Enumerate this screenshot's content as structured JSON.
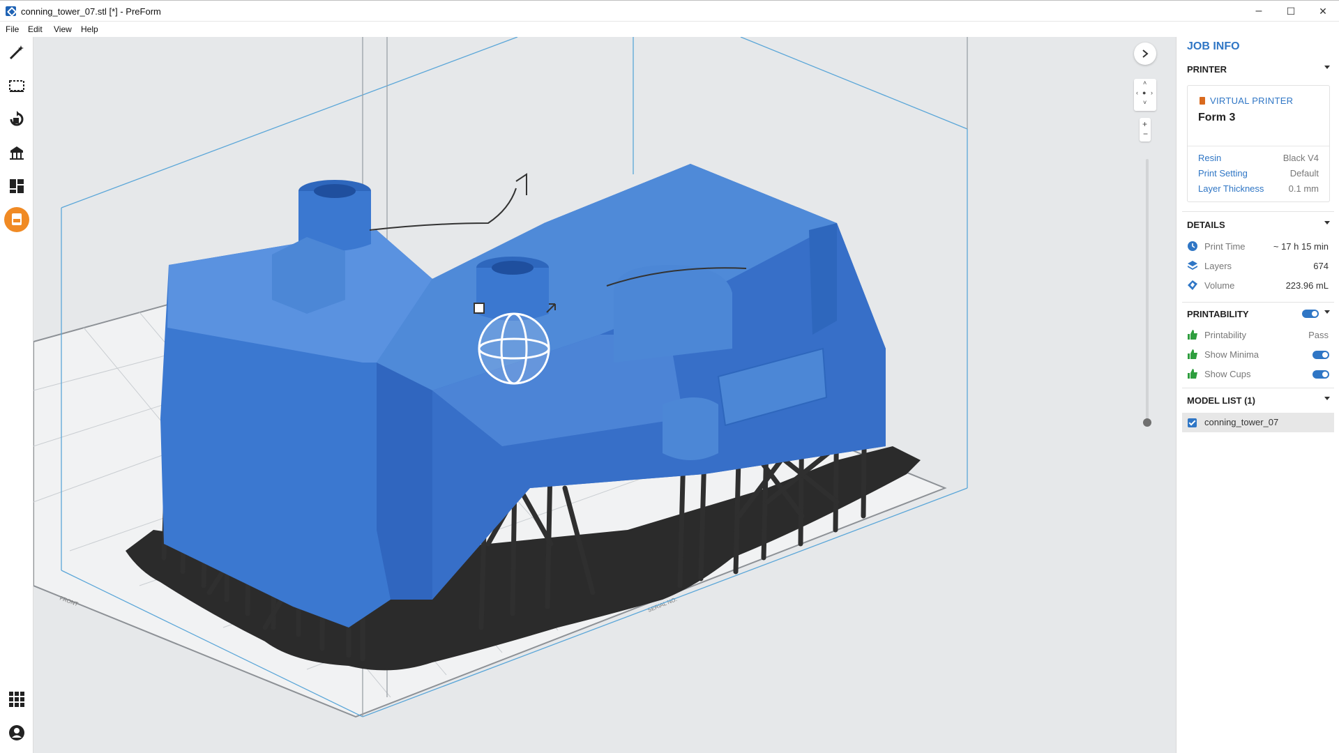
{
  "window": {
    "title": "conning_tower_07.stl [*] - PreForm",
    "minimize": "–",
    "maximize": "☐",
    "close": "✕"
  },
  "menu": [
    "File",
    "Edit",
    "View",
    "Help"
  ],
  "toolbar": {
    "tools": [
      "magic-wand-icon",
      "select-box-icon",
      "orientation-icon",
      "supports-icon",
      "layout-icon",
      "print-icon"
    ],
    "bottom": [
      "apps-grid-icon",
      "account-icon"
    ],
    "active_tool_color": "#f08a24"
  },
  "viewport": {
    "background": "#e6e8ea",
    "model_color": "#3b78d0",
    "support_color": "#2b2b2b",
    "build_box_color": "#5aa6d8",
    "platform_labels": [
      "FRONT",
      "SERIAL NO."
    ]
  },
  "job_info": {
    "title": "JOB INFO",
    "printer": {
      "header": "PRINTER",
      "virtual_label": "VIRTUAL PRINTER",
      "name": "Form 3",
      "rows": [
        {
          "label": "Resin",
          "value": "Black V4"
        },
        {
          "label": "Print Setting",
          "value": "Default"
        },
        {
          "label": "Layer Thickness",
          "value": "0.1 mm"
        }
      ]
    },
    "details": {
      "header": "DETAILS",
      "rows": [
        {
          "icon": "clock-icon",
          "label": "Print Time",
          "value": "~ 17 h 15 min"
        },
        {
          "icon": "layers-icon",
          "label": "Layers",
          "value": "674"
        },
        {
          "icon": "volume-icon",
          "label": "Volume",
          "value": "223.96 mL"
        }
      ]
    },
    "printability": {
      "header": "PRINTABILITY",
      "enabled": true,
      "rows": [
        {
          "icon": "thumbs-up-icon",
          "label": "Printability",
          "value": "Pass"
        },
        {
          "icon": "thumbs-up-icon",
          "label": "Show Minima",
          "toggle": true
        },
        {
          "icon": "thumbs-up-icon",
          "label": "Show Cups",
          "toggle": true
        }
      ]
    },
    "model_list": {
      "header": "MODEL LIST (1)",
      "items": [
        {
          "name": "conning_tower_07",
          "checked": true
        }
      ]
    }
  },
  "accent_color": "#2f76c5",
  "ok_color": "#2e9e3e"
}
